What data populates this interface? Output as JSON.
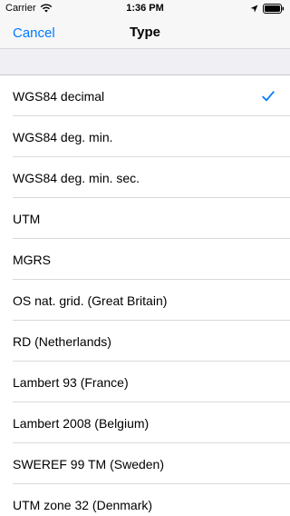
{
  "status_bar": {
    "carrier": "Carrier",
    "time": "1:36 PM",
    "icons": [
      "wifi-icon",
      "location-icon",
      "battery-icon"
    ]
  },
  "nav": {
    "cancel_label": "Cancel",
    "title": "Type"
  },
  "colors": {
    "accent": "#007aff",
    "header_bg": "#efeff4",
    "separator": "#d9d9dd"
  },
  "list": {
    "items": [
      {
        "label": "WGS84 decimal",
        "selected": true
      },
      {
        "label": "WGS84 deg. min.",
        "selected": false
      },
      {
        "label": "WGS84 deg. min. sec.",
        "selected": false
      },
      {
        "label": "UTM",
        "selected": false
      },
      {
        "label": "MGRS",
        "selected": false
      },
      {
        "label": "OS nat. grid. (Great Britain)",
        "selected": false
      },
      {
        "label": "RD (Netherlands)",
        "selected": false
      },
      {
        "label": "Lambert 93 (France)",
        "selected": false
      },
      {
        "label": "Lambert 2008 (Belgium)",
        "selected": false
      },
      {
        "label": "SWEREF 99 TM (Sweden)",
        "selected": false
      },
      {
        "label": "UTM zone 32 (Denmark)",
        "selected": false
      }
    ]
  }
}
